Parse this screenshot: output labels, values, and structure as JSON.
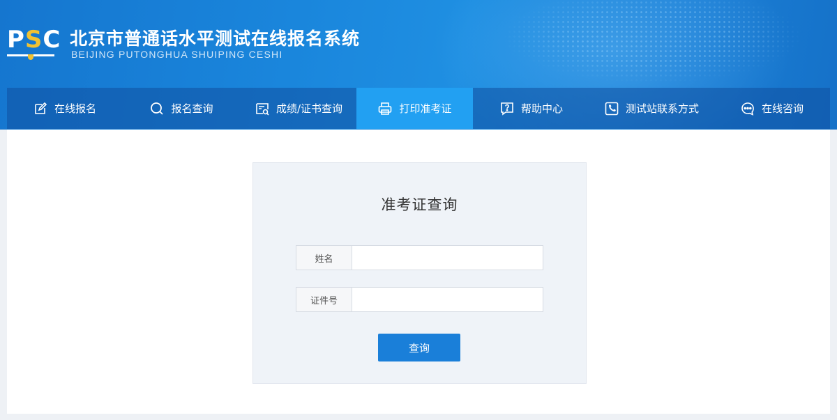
{
  "header": {
    "logo_text_p": "P",
    "logo_text_s": "S",
    "logo_text_c": "C",
    "title": "北京市普通话水平测试在线报名系统",
    "subtitle": "BEIJING PUTONGHUA SHUIPING CESHI"
  },
  "nav": {
    "items": [
      {
        "label": "在线报名",
        "icon": "edit-icon"
      },
      {
        "label": "报名查询",
        "icon": "search-icon"
      },
      {
        "label": "成绩/证书查询",
        "icon": "certificate-search-icon"
      },
      {
        "label": "打印准考证",
        "icon": "printer-icon",
        "active": true
      },
      {
        "label": "帮助中心",
        "icon": "help-icon"
      },
      {
        "label": "测试站联系方式",
        "icon": "phone-icon"
      },
      {
        "label": "在线咨询",
        "icon": "chat-icon"
      }
    ]
  },
  "form": {
    "title": "准考证查询",
    "name_label": "姓名",
    "name_value": "",
    "id_label": "证件号",
    "id_value": "",
    "submit_label": "查询"
  },
  "colors": {
    "header_blue": "#1a86dc",
    "nav_active": "#22a0f2",
    "button_blue": "#1a7fd9",
    "logo_accent": "#f1c232"
  }
}
